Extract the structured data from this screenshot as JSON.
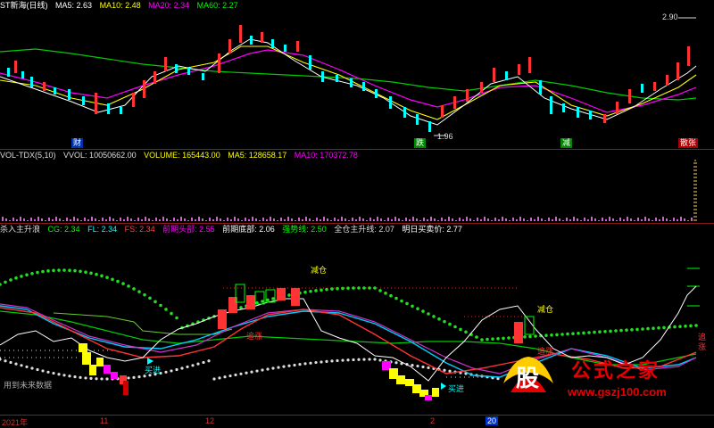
{
  "main": {
    "title": "ST新海(日线)",
    "ma5_label": "MA5: 2.63",
    "ma10_label": "MA10: 2.48",
    "ma20_label": "MA20: 2.34",
    "ma60_label": "MA60: 2.27",
    "high_price": "2.90",
    "low_price": "1.96",
    "markers": [
      "财",
      "跌",
      "减",
      "散张"
    ]
  },
  "volume": {
    "indicator": "VOL-TDX(5,10)",
    "vvol": "VVOL: 10050662.00",
    "volume": "VOLUME: 165443.00",
    "ma5": "MA5: 128658.17",
    "ma10": "MA10: 170372.78"
  },
  "indicator": {
    "name": "杀入主升浪",
    "cg": "CG: 2.34",
    "fl": "FL: 2.34",
    "fs": "FS: 2.34",
    "prev_top": "前期头部: 2.55",
    "prev_bottom": "前期底部: 2.06",
    "strong_line": "强势线: 2.50",
    "main_rise_line": "全仓主升线: 2.07",
    "tomorrow_price": "明日买卖价: 2.77",
    "labels": {
      "reduce1": "减仓",
      "reduce2": "减仓",
      "chase1": "追涨",
      "chase2": "追涨",
      "buy1": "买进",
      "buy2": "买进",
      "chase3": "追涨"
    },
    "future_note": "用到未来数据"
  },
  "axis": {
    "year": "2021年",
    "m11": "11",
    "m12": "12",
    "m2": "2",
    "d20": "20"
  },
  "watermark": {
    "logo_char": "股",
    "text": "公式之家",
    "url": "www.gszj100.com"
  },
  "colors": {
    "ma5": "#ffffff",
    "ma10": "#ffff00",
    "ma20": "#ff00ff",
    "ma60": "#00ff00",
    "up": "#ff3333",
    "down": "#00ffff",
    "grid": "#8b1a1a"
  }
}
